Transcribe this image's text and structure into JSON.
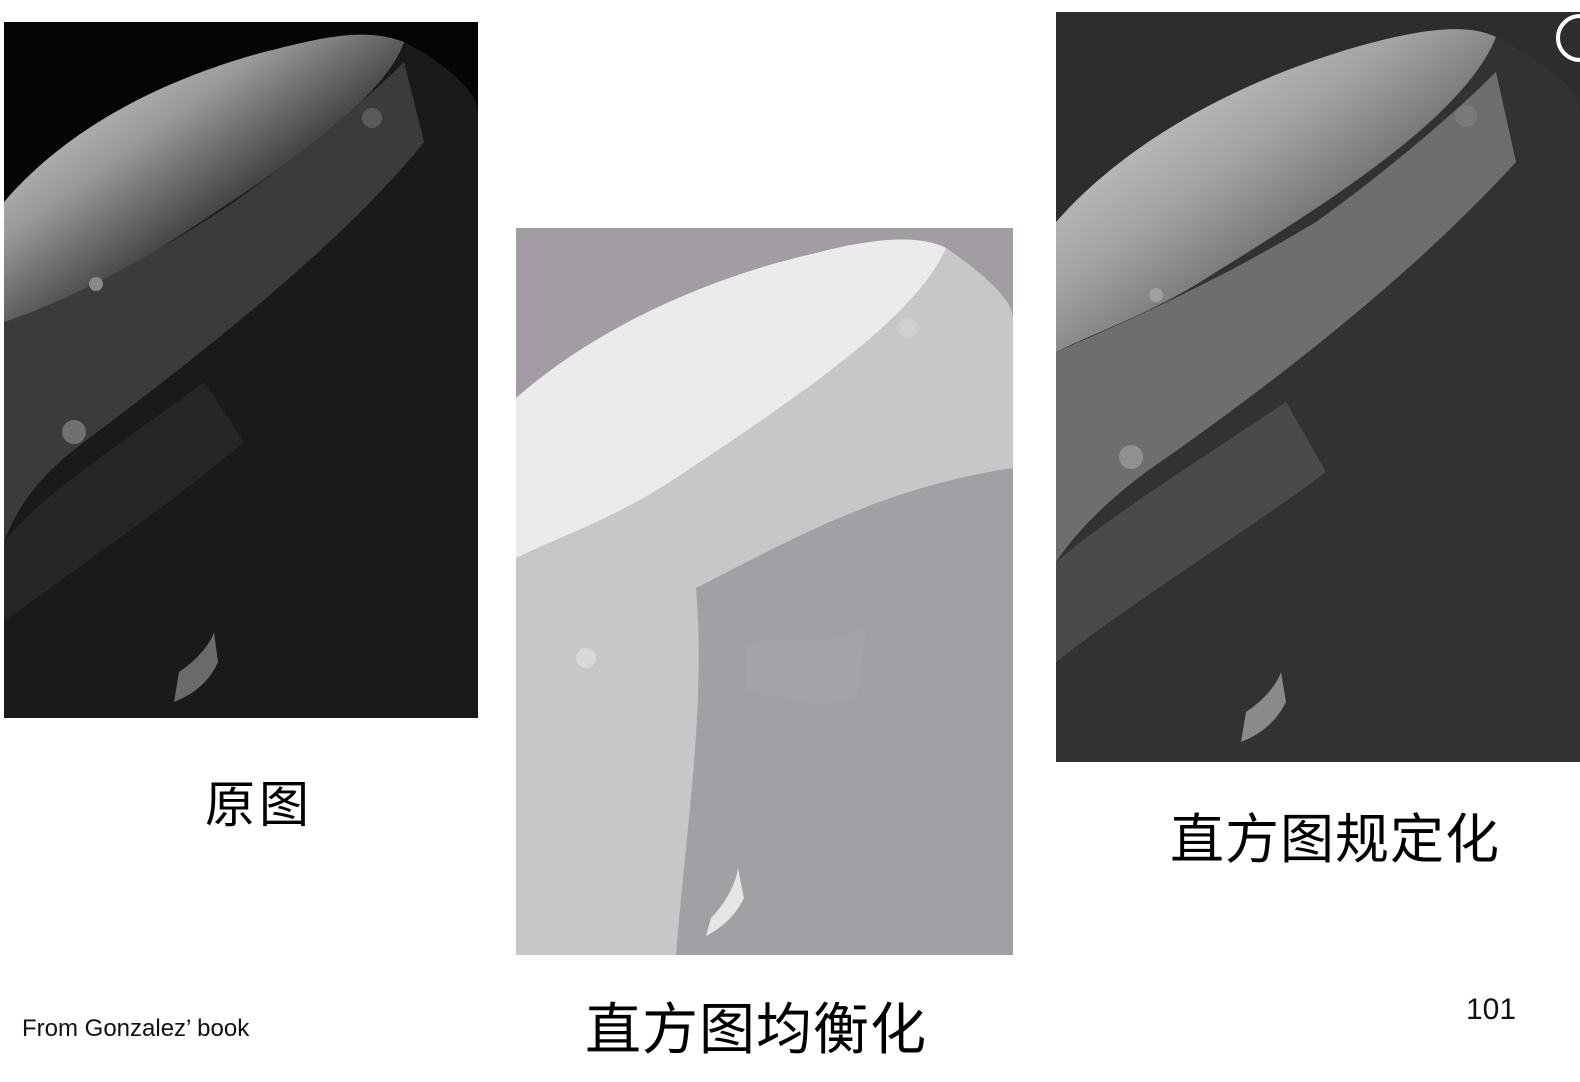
{
  "captions": {
    "original": "原图",
    "equalized": "直方图均衡化",
    "specified": "直方图规定化"
  },
  "footer": {
    "source_credit": "From Gonzalez’ book",
    "page_number": "101"
  },
  "images": {
    "original": {
      "description_icon": "moon-phobos-image",
      "background": "#050505"
    },
    "equalized": {
      "description_icon": "moon-phobos-image",
      "background": "#a19da2"
    },
    "specified": {
      "description_icon": "moon-phobos-image",
      "background": "#2d2d2d"
    }
  }
}
